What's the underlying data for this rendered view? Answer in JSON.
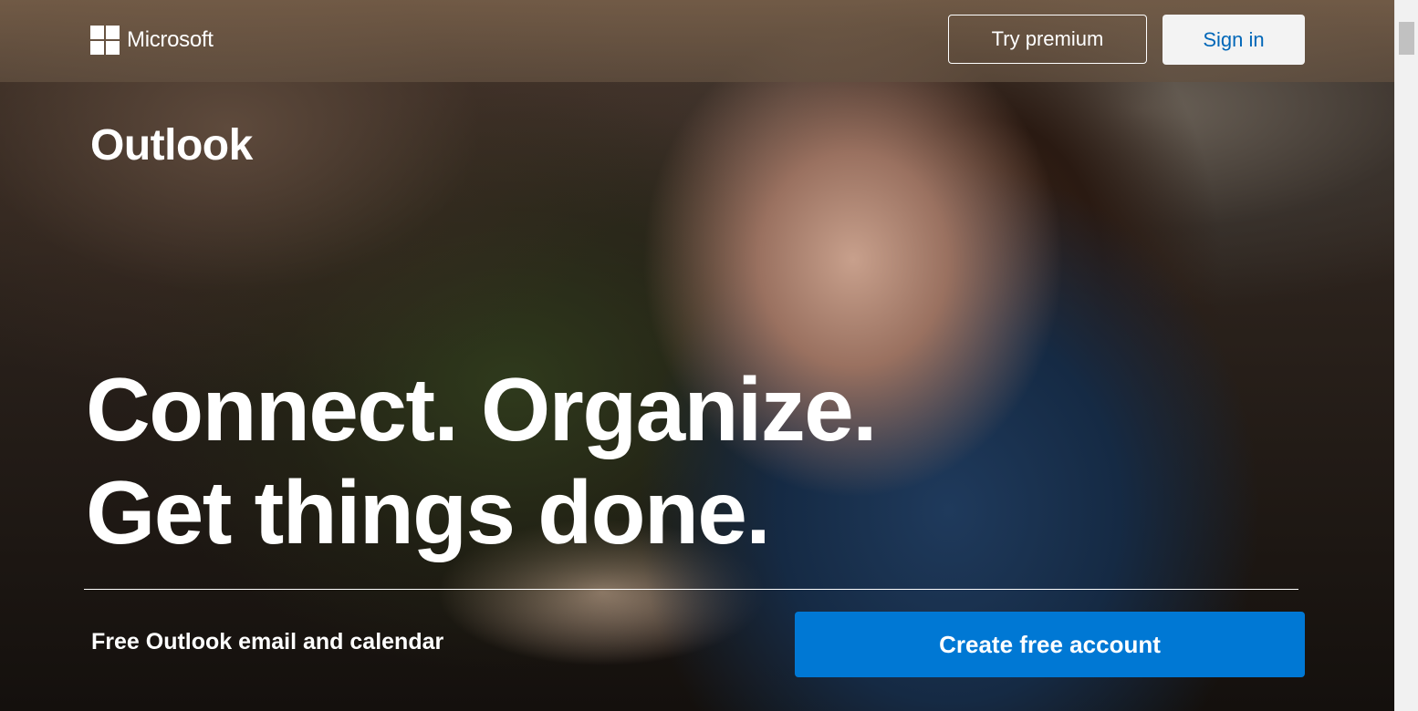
{
  "header": {
    "brand": "Microsoft",
    "try_premium_label": "Try premium",
    "sign_in_label": "Sign in"
  },
  "hero": {
    "product_title": "Outlook",
    "headline_line1": "Connect. Organize.",
    "headline_line2": "Get things done.",
    "subtext": "Free Outlook email and calendar",
    "cta_label": "Create free account"
  },
  "colors": {
    "cta_blue": "#0078d4",
    "sign_in_text": "#0067b8",
    "sign_in_bg": "#f3f3f3"
  },
  "icons": {
    "logo": "microsoft-logo-icon"
  }
}
